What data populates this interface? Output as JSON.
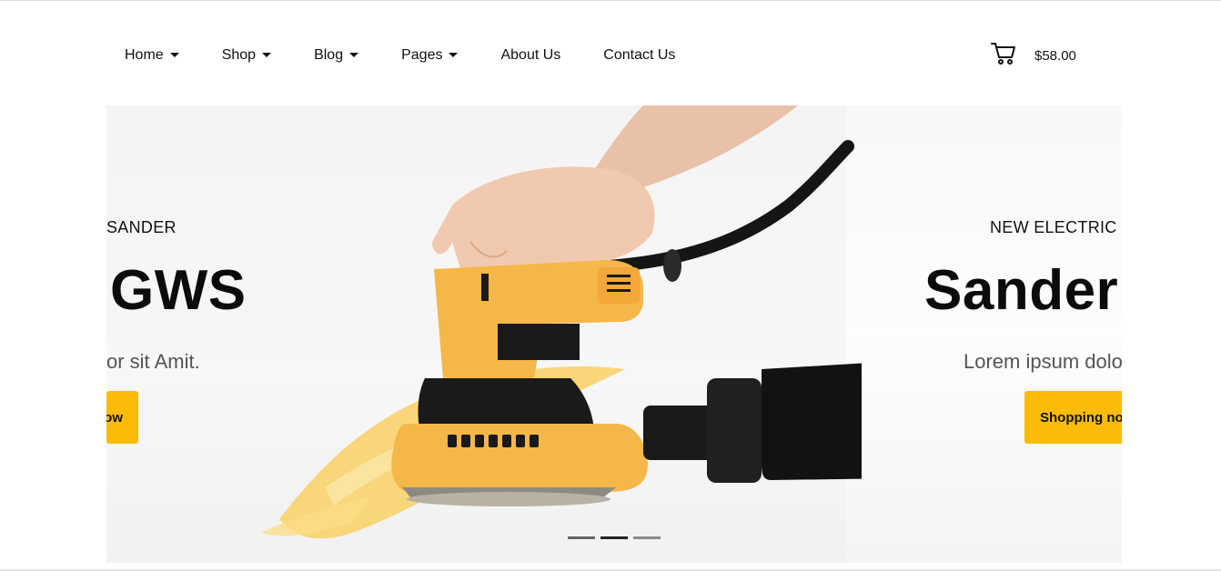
{
  "nav": {
    "items": [
      {
        "label": "Home",
        "dropdown": true
      },
      {
        "label": "Shop",
        "dropdown": true
      },
      {
        "label": "Blog",
        "dropdown": true
      },
      {
        "label": "Pages",
        "dropdown": true
      },
      {
        "label": "About Us",
        "dropdown": false
      },
      {
        "label": "Contact Us",
        "dropdown": false
      }
    ]
  },
  "cart": {
    "icon": "shopping-cart-icon",
    "total": "$58.00"
  },
  "slider": {
    "left_slide": {
      "subtitle": "SANDER",
      "headline": "GWS",
      "description": "or sit Amit.",
      "button_label": "ow"
    },
    "right_slide": {
      "subtitle": "NEW ELECTRIC S",
      "headline": "Sander",
      "description": "Lorem ipsum dolo",
      "button_label": "Shopping no"
    },
    "dots": [
      {
        "active": false
      },
      {
        "active": true
      },
      {
        "active": false
      }
    ],
    "colors": {
      "accent": "#fbbc09",
      "tool_body": "#f5b749",
      "tool_dark": "#1a1a1a"
    }
  }
}
